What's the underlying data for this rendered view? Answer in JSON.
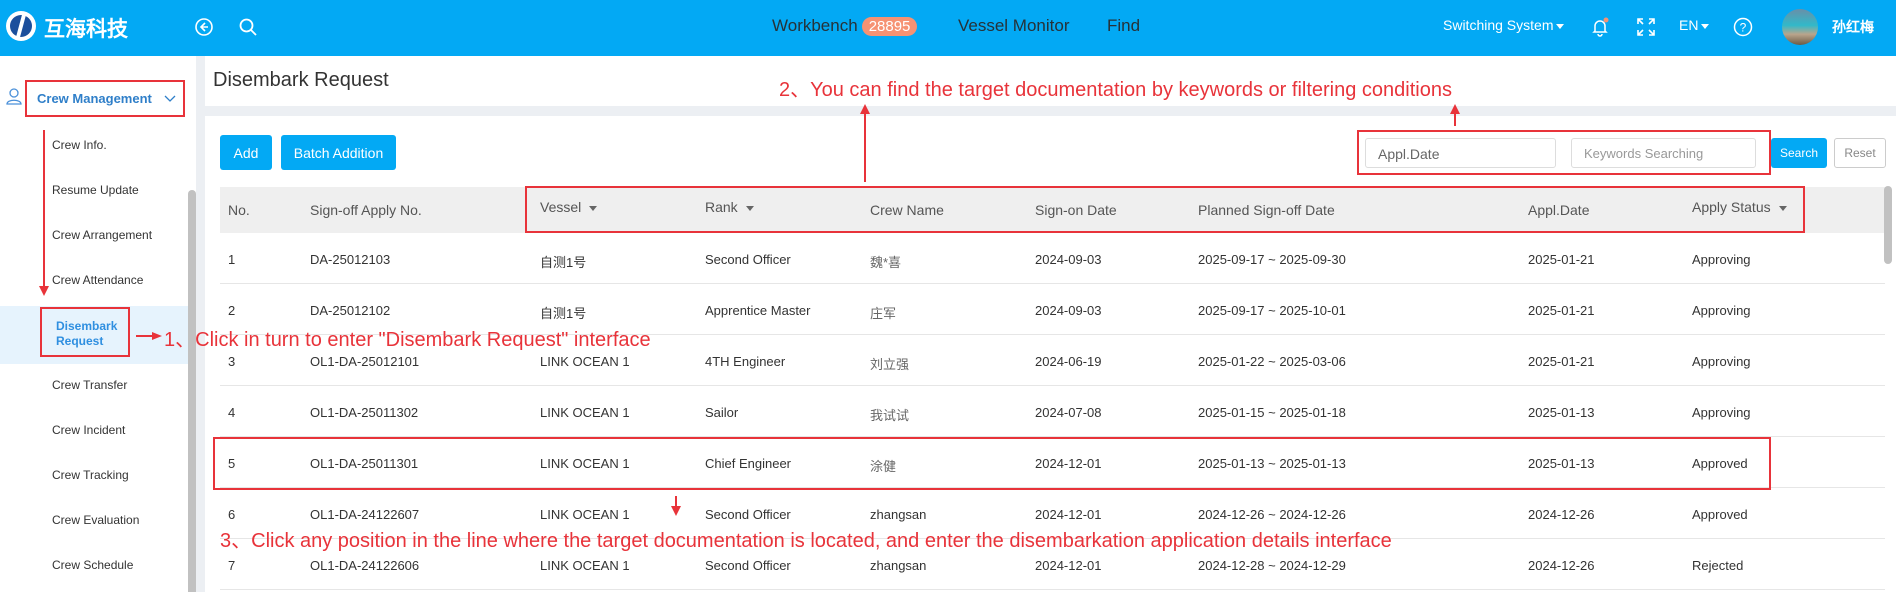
{
  "header": {
    "brand": "互海科技",
    "nav": [
      {
        "label": "Workbench",
        "badge": "28895"
      },
      {
        "label": "Vessel Monitor"
      },
      {
        "label": "Find"
      }
    ],
    "switching_system": "Switching System",
    "language": "EN",
    "user_name": "孙红梅",
    "icons": {
      "back": "back-circle-icon",
      "search": "search-icon",
      "bell": "bell-icon",
      "fullscreen": "fullscreen-icon",
      "help": "help-icon"
    }
  },
  "sidebar": {
    "group_label": "Crew Management",
    "items": [
      {
        "label": "Crew Info."
      },
      {
        "label": "Resume Update"
      },
      {
        "label": "Crew Arrangement"
      },
      {
        "label": "Crew Attendance"
      },
      {
        "label": "Disembark Request",
        "line1": "Disembark",
        "line2": "Request",
        "active": true
      },
      {
        "label": "Crew Transfer"
      },
      {
        "label": "Crew Incident"
      },
      {
        "label": "Crew Tracking"
      },
      {
        "label": "Crew Evaluation"
      },
      {
        "label": "Crew Schedule"
      }
    ]
  },
  "page": {
    "title": "Disembark Request",
    "buttons": {
      "add": "Add",
      "batch_addition": "Batch Addition",
      "search": "Search",
      "reset": "Reset"
    },
    "filters": {
      "appl_date_placeholder": "Appl.Date",
      "keywords_placeholder": "Keywords Searching"
    }
  },
  "table": {
    "columns": [
      "No.",
      "Sign-off Apply No.",
      "Vessel",
      "Rank",
      "Crew Name",
      "Sign-on Date",
      "Planned Sign-off Date",
      "Appl.Date",
      "Apply Status"
    ],
    "rows": [
      [
        "1",
        "DA-25012103",
        "自测1号",
        "Second Officer",
        "魏*喜",
        "2024-09-03",
        "2025-09-17 ~ 2025-09-30",
        "2025-01-21",
        "Approving"
      ],
      [
        "2",
        "DA-25012102",
        "自测1号",
        "Apprentice Master",
        "庄军",
        "2024-09-03",
        "2025-09-17 ~ 2025-10-01",
        "2025-01-21",
        "Approving"
      ],
      [
        "3",
        "OL1-DA-25012101",
        "LINK OCEAN 1",
        "4TH Engineer",
        "刘立强",
        "2024-06-19",
        "2025-01-22 ~ 2025-03-06",
        "2025-01-21",
        "Approving"
      ],
      [
        "4",
        "OL1-DA-25011302",
        "LINK OCEAN 1",
        "Sailor",
        "我试试",
        "2024-07-08",
        "2025-01-15 ~ 2025-01-18",
        "2025-01-13",
        "Approving"
      ],
      [
        "5",
        "OL1-DA-25011301",
        "LINK OCEAN 1",
        "Chief Engineer",
        "涂健",
        "2024-12-01",
        "2025-01-13 ~ 2025-01-13",
        "2025-01-13",
        "Approved"
      ],
      [
        "6",
        "OL1-DA-24122607",
        "LINK OCEAN 1",
        "Second Officer",
        "zhangsan",
        "2024-12-01",
        "2024-12-26 ~ 2024-12-26",
        "2024-12-26",
        "Approved"
      ],
      [
        "7",
        "OL1-DA-24122606",
        "LINK OCEAN 1",
        "Second Officer",
        "zhangsan",
        "2024-12-01",
        "2024-12-28 ~ 2024-12-29",
        "2024-12-26",
        "Rejected"
      ]
    ]
  },
  "annotations": {
    "step1": "1、Click  in turn  to enter \"Disembark Request\" interface",
    "step2": "2、You can find the target documentation by keywords or filtering conditions",
    "step3": "3、Click any position in the line where the target documentation is located, and enter the disembarkation application details interface"
  },
  "colors": {
    "header": "#03a9f4",
    "badge": "#f69273",
    "annotation": "#e8333a",
    "active": "#2f8fe0"
  }
}
